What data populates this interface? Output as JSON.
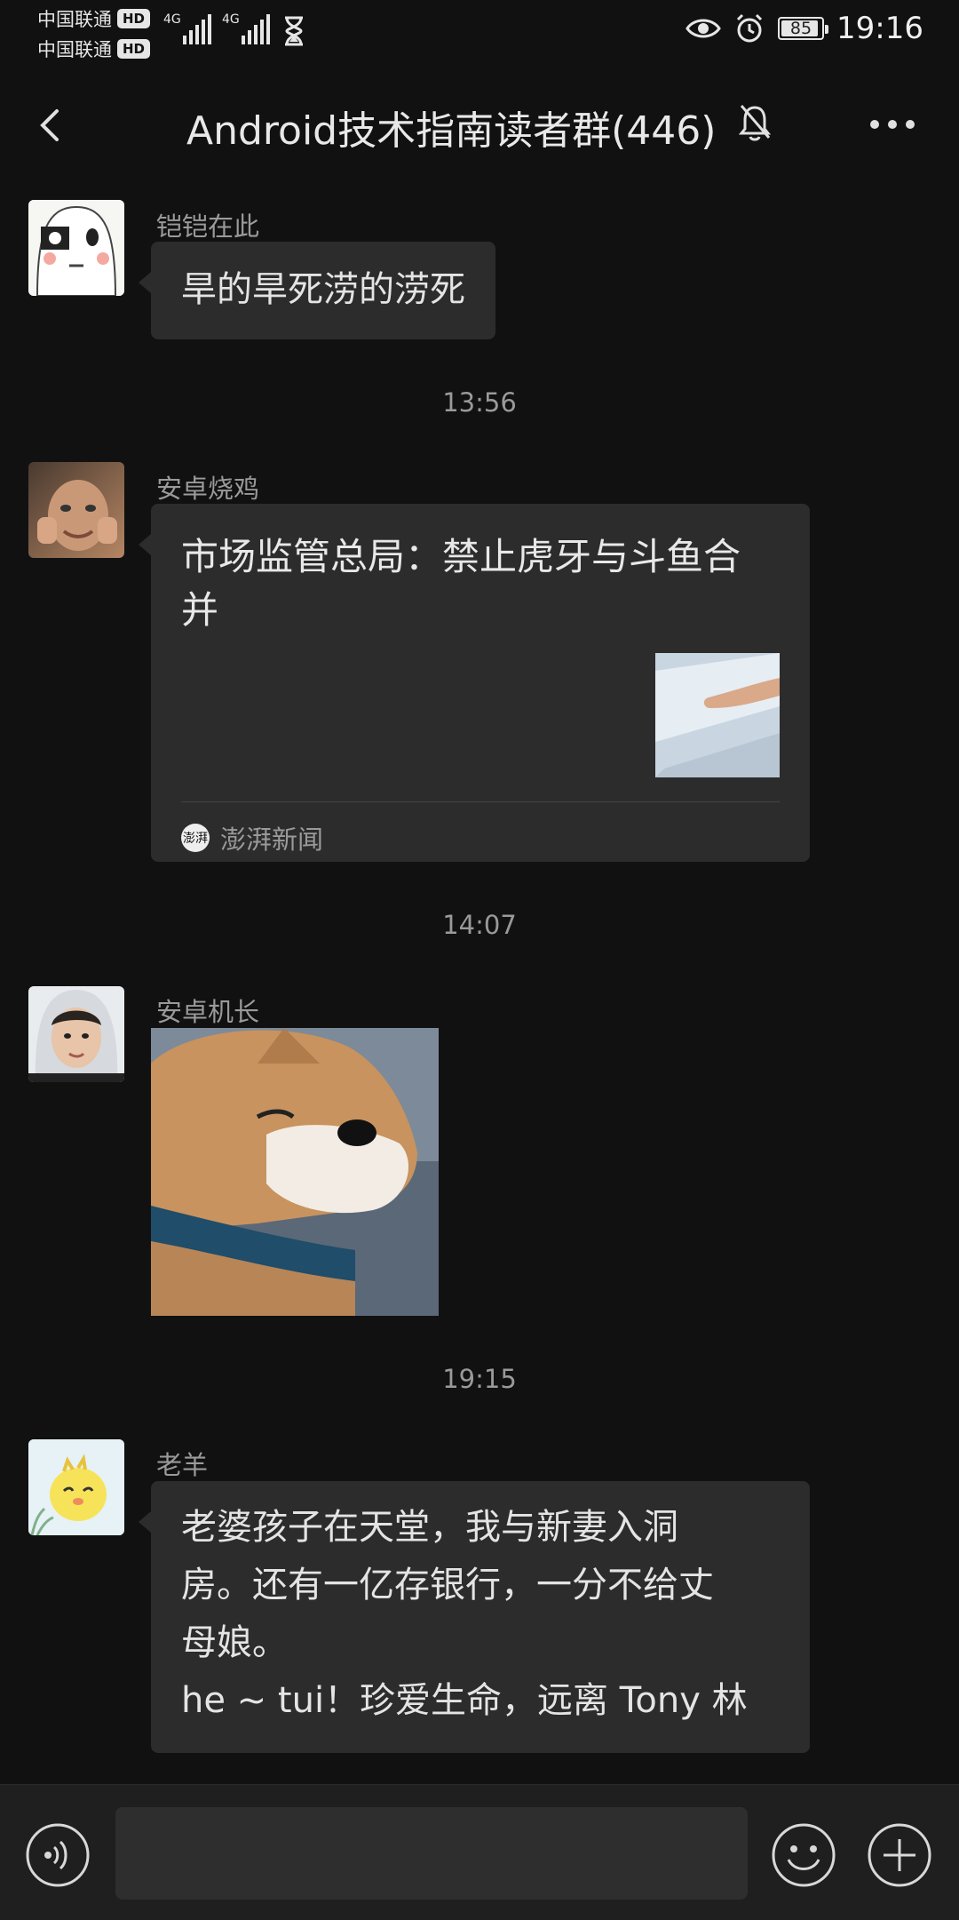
{
  "status_bar": {
    "carrier1": "中国联通",
    "carrier2": "中国联通",
    "hd": "HD",
    "network1": "4G",
    "network2": "4G",
    "battery": "85",
    "time": "19:16"
  },
  "header": {
    "title": "Android技术指南读者群(446)"
  },
  "messages": [
    {
      "sender": "铠铠在此",
      "text": "旱的旱死涝的涝死"
    },
    {
      "time": "13:56"
    },
    {
      "sender": "安卓烧鸡",
      "card_title": "市场监管总局：禁止虎牙与斗鱼合并",
      "card_source": "澎湃新闻",
      "card_source_logo": "澎湃"
    },
    {
      "time": "14:07"
    },
    {
      "sender": "安卓机长"
    },
    {
      "time": "19:15"
    },
    {
      "sender": "老羊",
      "text_lines": [
        "老婆孩子在天堂，我与新妻入洞",
        "房。还有一亿存银行，一分不给丈",
        "母娘。",
        "he ~ tui！珍爱生命，远离 Tony 林"
      ]
    }
  ],
  "colors": {
    "background": "#111111",
    "bubble": "#2c2c2c",
    "meta_text": "#9a9a9a"
  }
}
